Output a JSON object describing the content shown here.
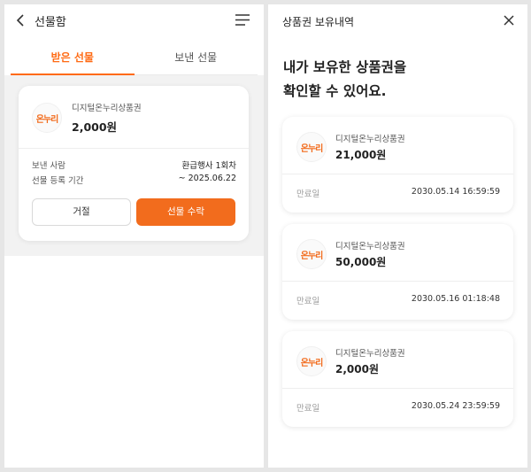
{
  "colors": {
    "accent": "#f26c1d",
    "background": "#e6e6e6",
    "card": "#ffffff"
  },
  "gift_box": {
    "title": "선물함",
    "icons": {
      "back": "chevron-left-icon",
      "menu": "hamburger-menu-icon"
    },
    "tabs": [
      {
        "label": "받은 선물",
        "active": true
      },
      {
        "label": "보낸 선물",
        "active": false
      }
    ],
    "card": {
      "logo_text": "온누리",
      "name": "디지털온누리상품권",
      "amount": "2,000원",
      "rows": [
        {
          "label": "보낸 사람",
          "value": "환급행사 1회차"
        },
        {
          "label": "선물 등록 기간",
          "value": "~ 2025.06.22"
        }
      ],
      "decline_label": "거절",
      "accept_label": "선물 수락"
    }
  },
  "voucher_history": {
    "title": "상품권 보유내역",
    "icons": {
      "close": "close-icon"
    },
    "heading_line1": "내가 보유한 상품권을",
    "heading_line2": "확인할 수 있어요.",
    "items": [
      {
        "logo_text": "온누리",
        "name": "디지털온누리상품권",
        "amount": "21,000원",
        "expiry_label": "만료일",
        "expiry": "2030.05.14 16:59:59"
      },
      {
        "logo_text": "온누리",
        "name": "디지털온누리상품권",
        "amount": "50,000원",
        "expiry_label": "만료일",
        "expiry": "2030.05.16 01:18:48"
      },
      {
        "logo_text": "온누리",
        "name": "디지털온누리상품권",
        "amount": "2,000원",
        "expiry_label": "만료일",
        "expiry": "2030.05.24 23:59:59"
      }
    ]
  }
}
